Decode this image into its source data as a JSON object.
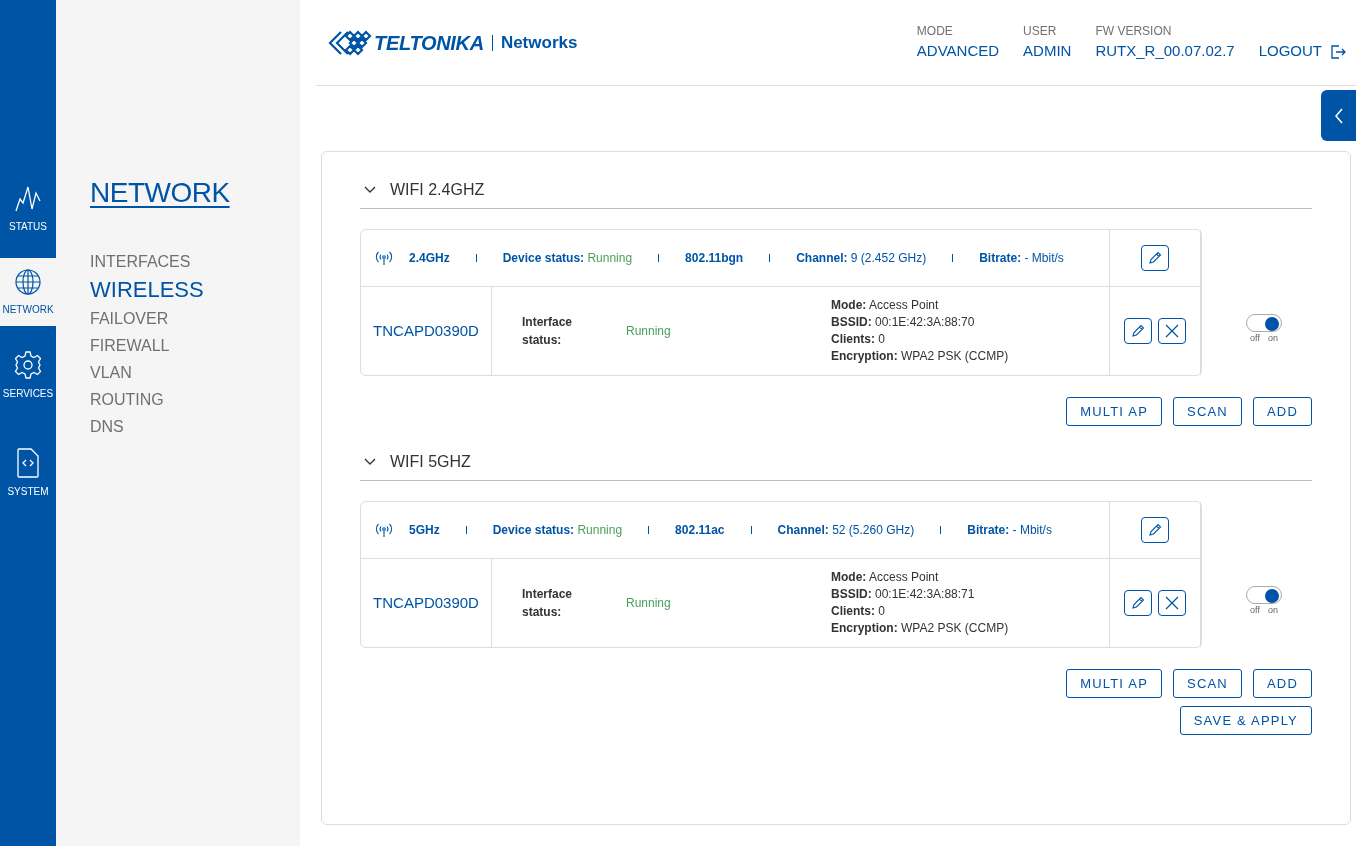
{
  "rail": [
    {
      "label": "STATUS",
      "kind": "pulse",
      "selected": false
    },
    {
      "label": "NETWORK",
      "kind": "globe",
      "selected": true
    },
    {
      "label": "SERVICES",
      "kind": "gear",
      "selected": false
    },
    {
      "label": "SYSTEM",
      "kind": "code",
      "selected": false
    }
  ],
  "section_title": "NETWORK",
  "menu": [
    {
      "label": "INTERFACES",
      "selected": false
    },
    {
      "label": "WIRELESS",
      "selected": true
    },
    {
      "label": "FAILOVER",
      "selected": false
    },
    {
      "label": "FIREWALL",
      "selected": false
    },
    {
      "label": "VLAN",
      "selected": false
    },
    {
      "label": "ROUTING",
      "selected": false
    },
    {
      "label": "DNS",
      "selected": false
    }
  ],
  "header": {
    "logo_brand": "TELTONIKA",
    "logo_sub": "Networks",
    "info": [
      {
        "label": "MODE",
        "value": "ADVANCED"
      },
      {
        "label": "USER",
        "value": "ADMIN"
      },
      {
        "label": "FW VERSION",
        "value": "RUTX_R_00.07.02.7"
      }
    ],
    "logout": "LOGOUT"
  },
  "radios": [
    {
      "title": "WIFI 2.4GHZ",
      "expanded": true,
      "band": "2.4GHz",
      "device_status_label": "Device status:",
      "device_status": "Running",
      "standard": "802.11bgn",
      "channel_label": "Channel:",
      "channel": "9 (2.452 GHz)",
      "bitrate_label": "Bitrate:",
      "bitrate": "- Mbit/s",
      "interfaces": [
        {
          "ssid": "TNCAPD0390D",
          "status_label": "Interface status:",
          "status": "Running",
          "details": [
            {
              "label": "Mode:",
              "value": "Access Point"
            },
            {
              "label": "BSSID:",
              "value": "00:1E:42:3A:88:70"
            },
            {
              "label": "Clients:",
              "value": "0"
            },
            {
              "label": "Encryption:",
              "value": "WPA2 PSK (CCMP)"
            }
          ],
          "on": true,
          "off_label": "off",
          "on_label": "on"
        }
      ],
      "buttons": [
        "MULTI AP",
        "SCAN",
        "ADD"
      ]
    },
    {
      "title": "WIFI 5GHZ",
      "expanded": true,
      "band": "5GHz",
      "device_status_label": "Device status:",
      "device_status": "Running",
      "standard": "802.11ac",
      "channel_label": "Channel:",
      "channel": "52 (5.260 GHz)",
      "bitrate_label": "Bitrate:",
      "bitrate": "- Mbit/s",
      "interfaces": [
        {
          "ssid": "TNCAPD0390D",
          "status_label": "Interface status:",
          "status": "Running",
          "details": [
            {
              "label": "Mode:",
              "value": "Access Point"
            },
            {
              "label": "BSSID:",
              "value": "00:1E:42:3A:88:71"
            },
            {
              "label": "Clients:",
              "value": "0"
            },
            {
              "label": "Encryption:",
              "value": "WPA2 PSK (CCMP)"
            }
          ],
          "on": true,
          "off_label": "off",
          "on_label": "on"
        }
      ],
      "buttons": [
        "MULTI AP",
        "SCAN",
        "ADD"
      ]
    }
  ],
  "save_button": "SAVE & APPLY"
}
